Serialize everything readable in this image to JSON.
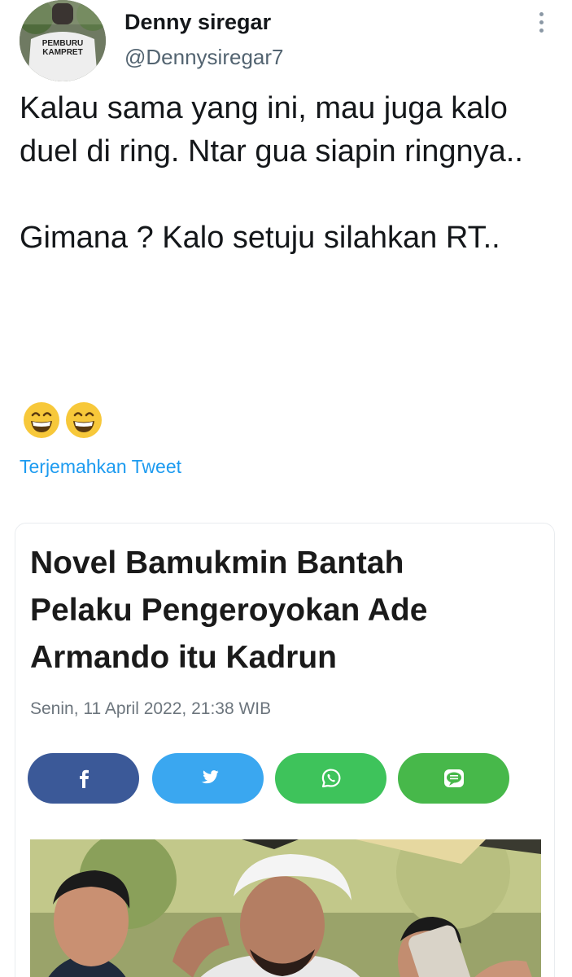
{
  "tweet": {
    "author_name": "Denny siregar",
    "author_handle": "@Dennysiregar7",
    "avatar_shirt_text": "PEMBURU KAMPRET",
    "paragraphs": [
      "Kalau sama yang ini, mau juga kalo duel di ring. Ntar gua siapin ringnya..",
      "Gimana ? Kalo setuju silahkan RT.."
    ],
    "emojis": [
      "grinning-face",
      "grinning-face"
    ],
    "translate_label": "Terjemahkan Tweet"
  },
  "article": {
    "headline": "Novel Bamukmin Bantah Pelaku Pengeroyokan Ade Armando itu Kadrun",
    "date": "Senin, 11 April 2022, 21:38 WIB",
    "share_buttons": [
      {
        "icon": "facebook-icon",
        "color": "#3b5998"
      },
      {
        "icon": "twitter-icon",
        "color": "#3aa7f0"
      },
      {
        "icon": "whatsapp-icon",
        "color": "#3ec35b"
      },
      {
        "icon": "line-icon",
        "color": "#47b84a"
      }
    ]
  }
}
